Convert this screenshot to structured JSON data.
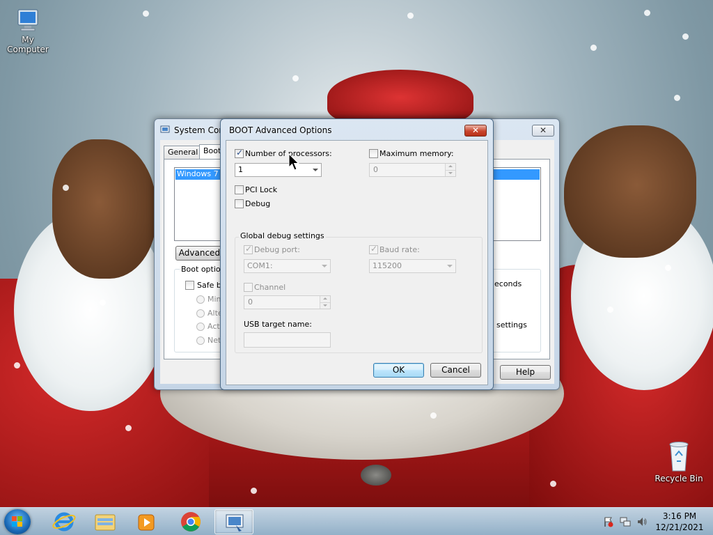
{
  "desktop": {
    "icons": [
      {
        "label": "My Computer",
        "icon": "computer-icon"
      },
      {
        "label": "Recycle Bin",
        "icon": "recycle-bin-icon"
      }
    ]
  },
  "sysconfig": {
    "title": "System Conf",
    "tabs": [
      "General",
      "Boot"
    ],
    "os_entry": "Windows 7 (C",
    "advanced_button": "Advanced o",
    "boot_options_label": "Boot options",
    "safe_boot": "Safe bo",
    "radios": [
      "Minim",
      "Alter",
      "Activ",
      "Netw"
    ],
    "seconds_label": "econds",
    "settings_label": "settings",
    "help_button": "Help"
  },
  "boot_adv": {
    "title": "BOOT Advanced Options",
    "num_processors_label": "Number of processors:",
    "num_processors_checked": true,
    "num_processors_value": "1",
    "max_memory_label": "Maximum memory:",
    "max_memory_checked": false,
    "max_memory_value": "0",
    "pci_lock_label": "PCI Lock",
    "debug_label": "Debug",
    "global_debug_label": "Global debug settings",
    "debug_port_label": "Debug port:",
    "debug_port_value": "COM1:",
    "baud_rate_label": "Baud rate:",
    "baud_rate_value": "115200",
    "channel_label": "Channel",
    "channel_value": "0",
    "usb_target_label": "USB target name:",
    "usb_target_value": "",
    "ok_button": "OK",
    "cancel_button": "Cancel"
  },
  "taskbar": {
    "pinned": [
      "windows-explorer-icon",
      "internet-explorer-icon",
      "media-player-icon",
      "chrome-icon",
      "system-configuration-icon"
    ],
    "tray_icons": [
      "action-center-icon",
      "network-icon",
      "volume-icon"
    ],
    "time": "3:16 PM",
    "date": "12/21/2021"
  },
  "colors": {
    "accent": "#3c7fb1",
    "selection": "#3399ff",
    "close_red": "#c9452d"
  }
}
